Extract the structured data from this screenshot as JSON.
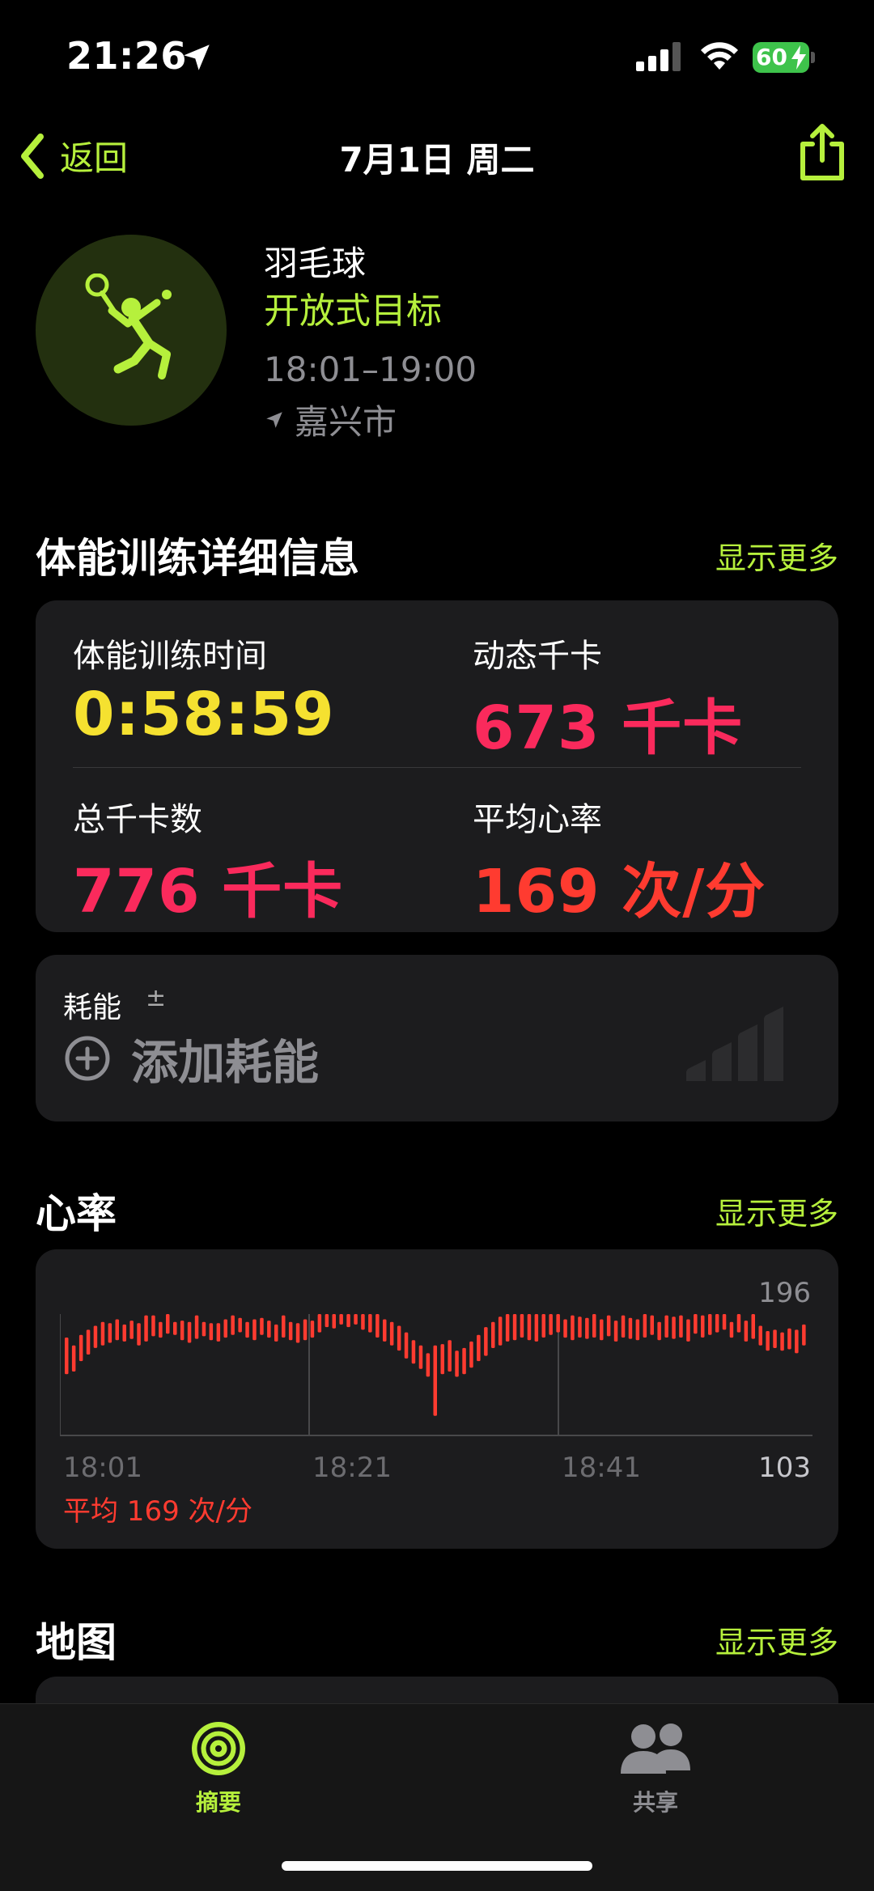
{
  "status": {
    "time": "21:26",
    "battery": "60"
  },
  "nav": {
    "back_label": "返回",
    "title": "7月1日 周二"
  },
  "workout": {
    "sport": "羽毛球",
    "goal": "开放式目标",
    "time_range": "18:01–19:00",
    "location": "嘉兴市"
  },
  "details": {
    "title": "体能训练详细信息",
    "show_more": "显示更多",
    "metrics": [
      {
        "label": "体能训练时间",
        "value": "0:58:59"
      },
      {
        "label": "动态千卡",
        "value": "673 千卡"
      },
      {
        "label": "总千卡数",
        "value": "776 千卡"
      },
      {
        "label": "平均心率",
        "value": "169 次/分"
      }
    ]
  },
  "effort": {
    "label": "耗能",
    "symbol": "±",
    "add_label": "添加耗能"
  },
  "heart_rate": {
    "title": "心率",
    "show_more": "显示更多",
    "max": "196",
    "min": "103",
    "avg": "平均 169 次/分",
    "x_ticks": [
      "18:01",
      "18:21",
      "18:41"
    ]
  },
  "map": {
    "title": "地图",
    "show_more": "显示更多"
  },
  "tabs": [
    {
      "label": "摘要",
      "active": true
    },
    {
      "label": "共享",
      "active": false
    }
  ],
  "colors": {
    "accent": "#b6f03c",
    "duration": "#f5e130",
    "calories": "#fa2a5c",
    "heart": "#ff3b30"
  },
  "chart_data": {
    "type": "bar",
    "title": "心率",
    "ylim": [
      103,
      196
    ],
    "x_ticks": [
      "18:01",
      "18:21",
      "18:41"
    ],
    "ranges": [
      [
        150,
        178
      ],
      [
        152,
        172
      ],
      [
        160,
        180
      ],
      [
        165,
        184
      ],
      [
        170,
        187
      ],
      [
        172,
        190
      ],
      [
        174,
        189
      ],
      [
        176,
        192
      ],
      [
        175,
        188
      ],
      [
        177,
        191
      ],
      [
        172,
        189
      ],
      [
        175,
        195
      ],
      [
        179,
        195
      ],
      [
        178,
        190
      ],
      [
        181,
        196
      ],
      [
        180,
        190
      ],
      [
        176,
        191
      ],
      [
        174,
        190
      ],
      [
        177,
        195
      ],
      [
        179,
        190
      ],
      [
        176,
        189
      ],
      [
        175,
        189
      ],
      [
        178,
        192
      ],
      [
        180,
        195
      ],
      [
        182,
        193
      ],
      [
        178,
        190
      ],
      [
        176,
        192
      ],
      [
        180,
        193
      ],
      [
        178,
        191
      ],
      [
        175,
        188
      ],
      [
        178,
        195
      ],
      [
        176,
        190
      ],
      [
        174,
        189
      ],
      [
        176,
        192
      ],
      [
        178,
        191
      ],
      [
        182,
        196
      ],
      [
        186,
        197
      ],
      [
        185,
        199
      ],
      [
        188,
        200
      ],
      [
        186,
        201
      ],
      [
        188,
        202
      ],
      [
        184,
        199
      ],
      [
        182,
        197
      ],
      [
        178,
        196
      ],
      [
        175,
        192
      ],
      [
        172,
        190
      ],
      [
        168,
        187
      ],
      [
        162,
        182
      ],
      [
        158,
        176
      ],
      [
        154,
        172
      ],
      [
        148,
        166
      ],
      [
        118,
        172
      ],
      [
        150,
        173
      ],
      [
        152,
        176
      ],
      [
        148,
        168
      ],
      [
        150,
        170
      ],
      [
        155,
        175
      ],
      [
        160,
        180
      ],
      [
        164,
        186
      ],
      [
        170,
        190
      ],
      [
        172,
        194
      ],
      [
        175,
        196
      ],
      [
        176,
        198
      ],
      [
        178,
        196
      ],
      [
        176,
        197
      ],
      [
        175,
        196
      ],
      [
        178,
        197
      ],
      [
        180,
        198
      ],
      [
        182,
        196
      ],
      [
        178,
        192
      ],
      [
        176,
        195
      ],
      [
        178,
        194
      ],
      [
        177,
        193
      ],
      [
        178,
        196
      ],
      [
        176,
        192
      ],
      [
        179,
        195
      ],
      [
        175,
        191
      ],
      [
        178,
        195
      ],
      [
        177,
        193
      ],
      [
        176,
        192
      ],
      [
        178,
        196
      ],
      [
        180,
        195
      ],
      [
        176,
        190
      ],
      [
        178,
        195
      ],
      [
        177,
        194
      ],
      [
        178,
        195
      ],
      [
        175,
        192
      ],
      [
        181,
        196
      ],
      [
        178,
        195
      ],
      [
        180,
        197
      ],
      [
        182,
        198
      ],
      [
        184,
        196
      ],
      [
        178,
        190
      ],
      [
        182,
        200
      ],
      [
        175,
        191
      ],
      [
        177,
        197
      ],
      [
        172,
        187
      ],
      [
        168,
        183
      ],
      [
        170,
        184
      ],
      [
        168,
        182
      ],
      [
        169,
        185
      ],
      [
        166,
        184
      ],
      [
        172,
        188
      ]
    ]
  }
}
